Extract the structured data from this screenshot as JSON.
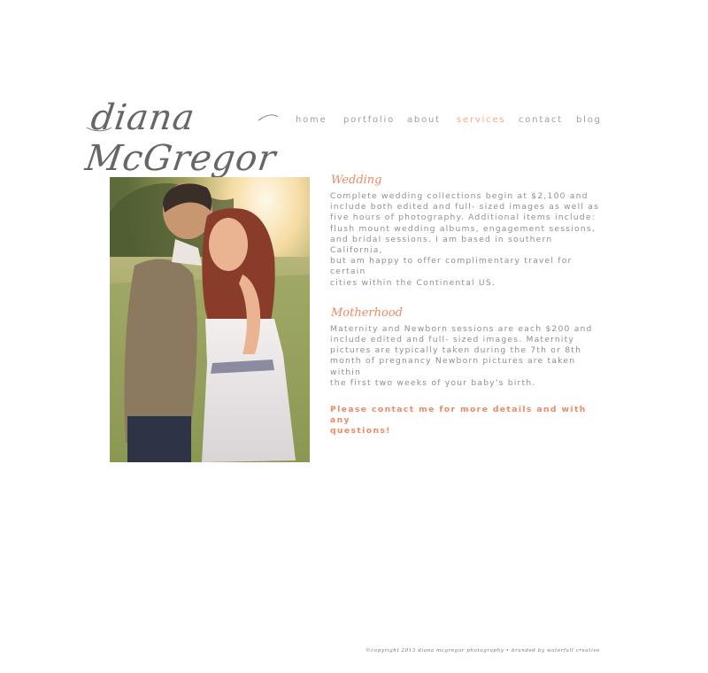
{
  "logo": {
    "text": "diana McGregor"
  },
  "nav": {
    "items": [
      {
        "label": "home"
      },
      {
        "label": "portfolio"
      },
      {
        "label": "about"
      },
      {
        "label": "services"
      },
      {
        "label": "contact"
      },
      {
        "label": "blog"
      }
    ],
    "active": "services"
  },
  "sections": [
    {
      "title": "Wedding",
      "body": "Complete wedding collections begin at $2,100 and\ninclude both edited and full- sized images as well as\nfive hours of photography.  Additional items include:\nflush mount wedding albums, engagement sessions,\nand bridal sessions. I am based in southern California,\nbut am happy to offer complimentary travel for certain\ncities within the  Continental US."
    },
    {
      "title": "Motherhood",
      "body": "Maternity and Newborn sessions are each $200 and\ninclude edited and full- sized images. Maternity\npictures are typically taken during the 7th or 8th\nmonth of pregnancy Newborn pictures are taken within\nthe first two weeks of your baby's birth."
    }
  ],
  "cta": "Please contact me for more details and with any\nquestions!",
  "footer": "©copyright 2013 diana mcgregor photography • branded by waterfall creative",
  "colors": {
    "accent": "#ee8a64",
    "nav_active": "#f1a98c",
    "text": "#8f8f8f"
  }
}
